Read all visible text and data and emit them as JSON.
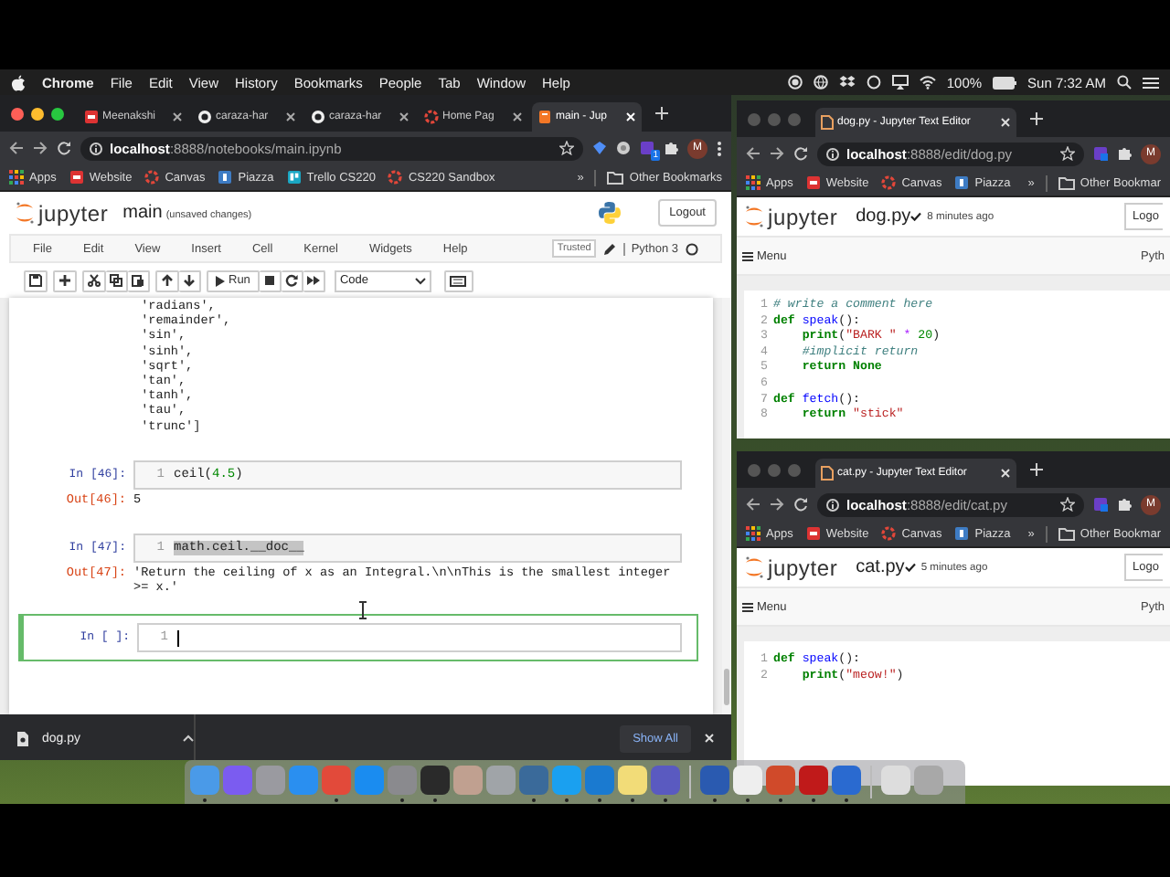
{
  "menubar": {
    "app": "Chrome",
    "menus": [
      "File",
      "Edit",
      "View",
      "History",
      "Bookmarks",
      "People",
      "Tab",
      "Window",
      "Help"
    ],
    "battery": "100%",
    "clock": "Sun 7:32 AM"
  },
  "main_window": {
    "tabs": [
      {
        "title": "Meenakshi",
        "selected": false
      },
      {
        "title": "caraza-har",
        "selected": false
      },
      {
        "title": "caraza-har",
        "selected": false
      },
      {
        "title": "Home Pag",
        "selected": false
      },
      {
        "title": "main - Jup",
        "selected": true
      }
    ],
    "address": "**localhost**:8888/notebooks/main.ipynb",
    "extension_badge": "1",
    "profile": "M",
    "bookmarks": [
      "Apps",
      "Website",
      "Canvas",
      "Piazza",
      "Trello CS220",
      "CS220 Sandbox"
    ],
    "more_bookmarks": "»",
    "other_bookmarks": "Other Bookmarks",
    "notebook": {
      "logo": "jupyter",
      "name": "main",
      "status": "(unsaved changes)",
      "logout": "Logout",
      "menus": [
        "File",
        "Edit",
        "View",
        "Insert",
        "Cell",
        "Kernel",
        "Widgets",
        "Help"
      ],
      "trusted": "Trusted",
      "kernel": "Python 3",
      "run": "Run",
      "cell_type": "Code",
      "cells": [
        {
          "kind": "output",
          "selected": false,
          "output": [
            " 'radians',",
            " 'remainder',",
            " 'sin',",
            " 'sinh',",
            " 'sqrt',",
            " 'tan',",
            " 'tanh',",
            " 'tau',",
            " 'trunc']"
          ]
        },
        {
          "kind": "code",
          "selected": false,
          "prompt": "In [46]:",
          "lines": [
            {
              "no": "1",
              "text_selected": false,
              "tokens": [
                {
                  "kind": "plain",
                  "text": "ceil("
                },
                {
                  "kind": "number",
                  "text": "4.5"
                },
                {
                  "kind": "plain",
                  "text": ")"
                }
              ]
            }
          ],
          "out_prompt": "Out[46]:",
          "output": [
            "5"
          ]
        },
        {
          "kind": "code",
          "selected": false,
          "prompt": "In [47]:",
          "lines": [
            {
              "no": "1",
              "text_selected": true,
              "tokens": [
                {
                  "kind": "plain",
                  "text": "math.ceil.__doc__"
                }
              ]
            }
          ],
          "out_prompt": "Out[47]:",
          "output": [
            "'Return the ceiling of x as an Integral.\\n\\nThis is the smallest integer",
            ">= x.'"
          ]
        },
        {
          "kind": "code",
          "selected": true,
          "prompt": "In [ ]:",
          "lines": [
            {
              "no": "1"
            }
          ]
        }
      ]
    },
    "download": {
      "file": "dog.py",
      "show_all": "Show All"
    }
  },
  "editors": [
    {
      "tab_title": "dog.py - Jupyter Text Editor",
      "address": "**localhost**:8888/edit/dog.py",
      "bookmarks": [
        "Apps",
        "Website",
        "Canvas",
        "Piazza"
      ],
      "more_bookmarks": "»",
      "other_bookmarks": "Other Bookmar",
      "profile": "M",
      "logo": "jupyter",
      "file": "dog.py",
      "saved": "8 minutes ago",
      "logout": "Logo",
      "menu": "Menu",
      "kernel": "Pyth",
      "lines": [
        {
          "no": "1",
          "tokens": [
            {
              "kind": "comment",
              "text": "# write a comment here"
            }
          ]
        },
        {
          "no": "2",
          "tokens": [
            {
              "kind": "keyword",
              "text": "def "
            },
            {
              "kind": "name",
              "text": "speak"
            },
            {
              "kind": "plain",
              "text": "():"
            }
          ]
        },
        {
          "no": "3",
          "tokens": [
            {
              "kind": "keyword",
              "text": "    print"
            },
            {
              "kind": "plain",
              "text": "("
            },
            {
              "kind": "string",
              "text": "\"BARK \""
            },
            {
              "kind": "op",
              "text": " * "
            },
            {
              "kind": "number",
              "text": "20"
            },
            {
              "kind": "plain",
              "text": ")"
            }
          ]
        },
        {
          "no": "4",
          "tokens": [
            {
              "kind": "comment",
              "text": "    #implicit return"
            }
          ]
        },
        {
          "no": "5",
          "tokens": [
            {
              "kind": "keyword",
              "text": "    return None"
            }
          ]
        },
        {
          "no": "6"
        },
        {
          "no": "7",
          "tokens": [
            {
              "kind": "keyword",
              "text": "def "
            },
            {
              "kind": "name",
              "text": "fetch"
            },
            {
              "kind": "plain",
              "text": "():"
            }
          ]
        },
        {
          "no": "8",
          "tokens": [
            {
              "kind": "keyword",
              "text": "    return "
            },
            {
              "kind": "string",
              "text": "\"stick\""
            }
          ]
        }
      ]
    },
    {
      "tab_title": "cat.py - Jupyter Text Editor",
      "address": "**localhost**:8888/edit/cat.py",
      "bookmarks": [
        "Apps",
        "Website",
        "Canvas",
        "Piazza"
      ],
      "more_bookmarks": "»",
      "other_bookmarks": "Other Bookmar",
      "profile": "M",
      "logo": "jupyter",
      "file": "cat.py",
      "saved": "5 minutes ago",
      "logout": "Logo",
      "menu": "Menu",
      "kernel": "Pyth",
      "lines": [
        {
          "no": "1",
          "tokens": [
            {
              "kind": "keyword",
              "text": "def "
            },
            {
              "kind": "name",
              "text": "speak"
            },
            {
              "kind": "plain",
              "text": "():"
            }
          ]
        },
        {
          "no": "2",
          "tokens": [
            {
              "kind": "keyword",
              "text": "    print"
            },
            {
              "kind": "plain",
              "text": "("
            },
            {
              "kind": "string",
              "text": "\"meow!\""
            },
            {
              "kind": "plain",
              "text": ")"
            }
          ]
        }
      ]
    }
  ],
  "dock": {
    "apps": [
      {
        "running": true
      },
      {
        "running": false
      },
      {
        "running": false
      },
      {
        "running": false
      },
      {
        "running": true
      },
      {
        "running": false
      },
      {
        "running": true
      },
      {
        "running": true
      },
      {
        "running": false
      },
      {
        "running": false
      },
      {
        "running": true
      },
      {
        "running": true
      },
      {
        "running": true
      },
      {
        "running": true
      },
      {
        "running": true
      }
    ],
    "recent_apps": [
      {
        "running": true
      },
      {
        "running": true
      },
      {
        "running": true
      },
      {
        "running": true
      },
      {
        "running": true
      }
    ],
    "stack": [
      {
        "running": false
      },
      {
        "running": false
      }
    ]
  }
}
